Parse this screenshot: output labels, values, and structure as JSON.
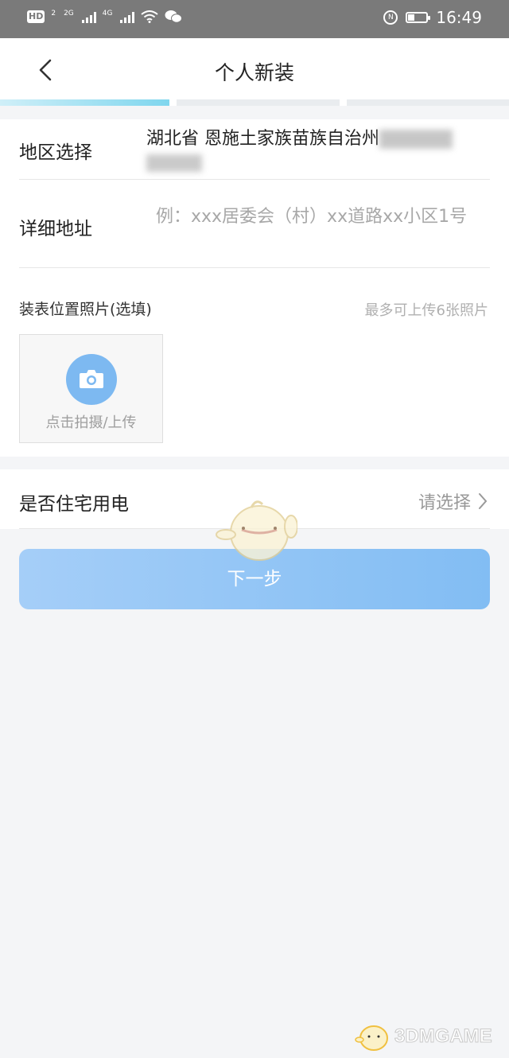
{
  "status_bar": {
    "hd_badge": "HD",
    "hd_sub": "2",
    "net1": "2G",
    "net2": "4G",
    "nfc_badge": "N",
    "time": "16:49"
  },
  "header": {
    "title": "个人新装",
    "back_icon": "chevron-left-icon"
  },
  "steps": {
    "total": 3,
    "current": 1
  },
  "form": {
    "region": {
      "label": "地区选择",
      "value": "湖北省 恩施土家族苗族自治州"
    },
    "address": {
      "label": "详细地址",
      "placeholder": "例：xxx居委会（村）xx道路xx小区1号"
    },
    "photo": {
      "label": "装表位置照片(选填)",
      "hint": "最多可上传6张照片",
      "upload_text": "点击拍摄/上传",
      "icon": "camera-icon"
    },
    "residential": {
      "label": "是否住宅用电",
      "select_text": "请选择",
      "chevron_icon": "chevron-right-icon"
    }
  },
  "next_button": {
    "label": "下一步"
  },
  "watermark": {
    "text": "3DMGAME"
  },
  "colors": {
    "accent": "#82bdf3",
    "progress_active": "#7fd6ee",
    "status_bar": "#7a7a7a",
    "background": "#f4f5f7"
  }
}
